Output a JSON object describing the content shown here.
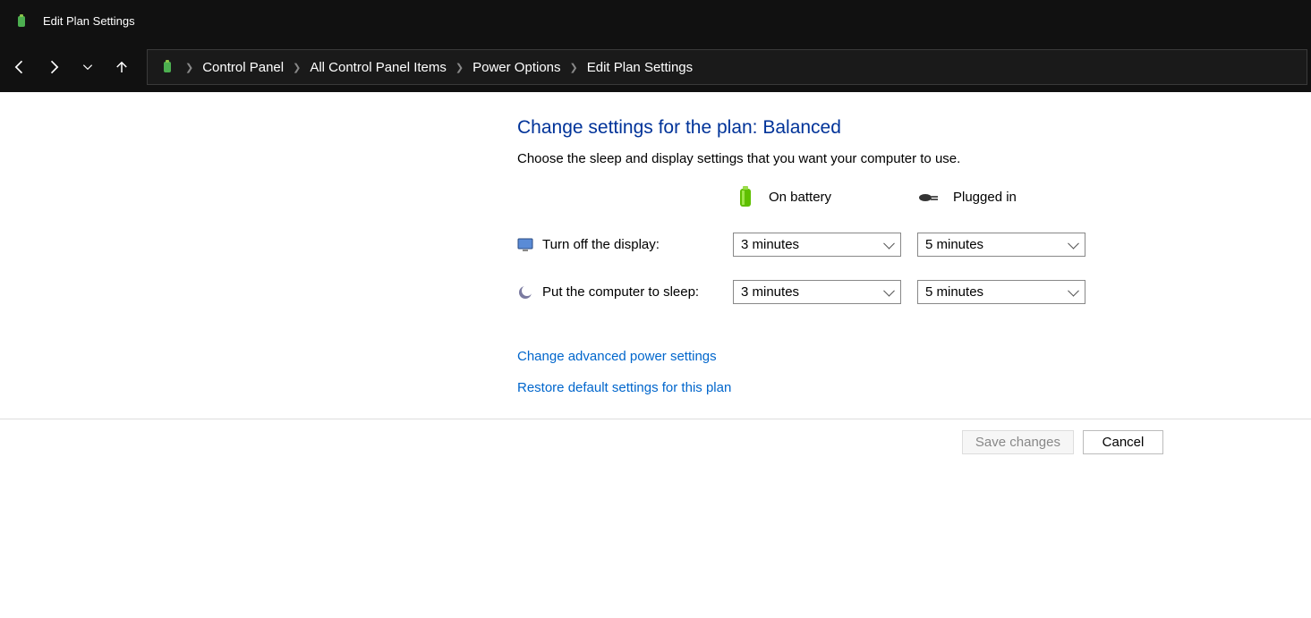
{
  "window": {
    "title": "Edit Plan Settings"
  },
  "breadcrumb": {
    "items": [
      "Control Panel",
      "All Control Panel Items",
      "Power Options",
      "Edit Plan Settings"
    ]
  },
  "main": {
    "heading": "Change settings for the plan: Balanced",
    "subhead": "Choose the sleep and display settings that you want your computer to use.",
    "columns": {
      "battery": "On battery",
      "plugged": "Plugged in"
    },
    "rows": {
      "display": {
        "label": "Turn off the display:",
        "battery_value": "3 minutes",
        "plugged_value": "5 minutes"
      },
      "sleep": {
        "label": "Put the computer to sleep:",
        "battery_value": "3 minutes",
        "plugged_value": "5 minutes"
      }
    },
    "links": {
      "advanced": "Change advanced power settings",
      "restore": "Restore default settings for this plan"
    }
  },
  "footer": {
    "save": "Save changes",
    "cancel": "Cancel"
  }
}
